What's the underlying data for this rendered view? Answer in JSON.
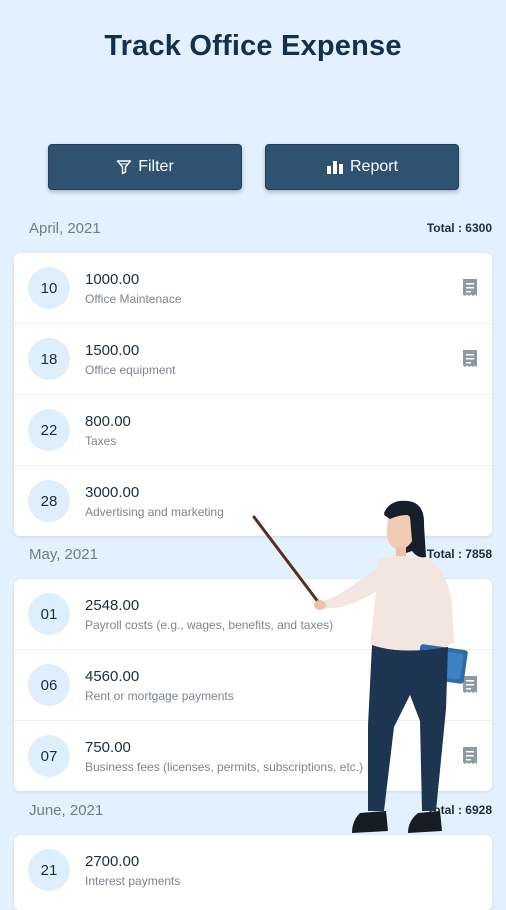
{
  "title": "Track Office Expense",
  "buttons": {
    "filter": "Filter",
    "report": "Report"
  },
  "months": [
    {
      "label": "April, 2021",
      "total": "Total : 6300",
      "items": [
        {
          "day": "10",
          "amount": "1000.00",
          "desc": "Office Maintenace",
          "receipt": true
        },
        {
          "day": "18",
          "amount": "1500.00",
          "desc": "Office equipment",
          "receipt": true
        },
        {
          "day": "22",
          "amount": "800.00",
          "desc": "Taxes",
          "receipt": false
        },
        {
          "day": "28",
          "amount": "3000.00",
          "desc": "Advertising and marketing",
          "receipt": false
        }
      ]
    },
    {
      "label": "May, 2021",
      "total": "Total : 7858",
      "items": [
        {
          "day": "01",
          "amount": "2548.00",
          "desc": "Payroll costs (e.g., wages, benefits, and taxes)",
          "receipt": false
        },
        {
          "day": "06",
          "amount": "4560.00",
          "desc": "Rent or mortgage payments",
          "receipt": true
        },
        {
          "day": "07",
          "amount": "750.00",
          "desc": "Business fees (licenses, permits, subscriptions, etc.)",
          "receipt": true
        }
      ]
    },
    {
      "label": "June, 2021",
      "total": "Total : 6928",
      "items": [
        {
          "day": "21",
          "amount": "2700.00",
          "desc": "Interest payments",
          "receipt": false
        }
      ]
    }
  ],
  "colors": {
    "background": "#e3f0fd",
    "button": "#2f5270",
    "badge": "#deeefb",
    "title": "#13304d"
  },
  "icons": {
    "filter": "funnel-icon",
    "report": "bar-chart-icon",
    "receipt": "receipt-icon"
  }
}
